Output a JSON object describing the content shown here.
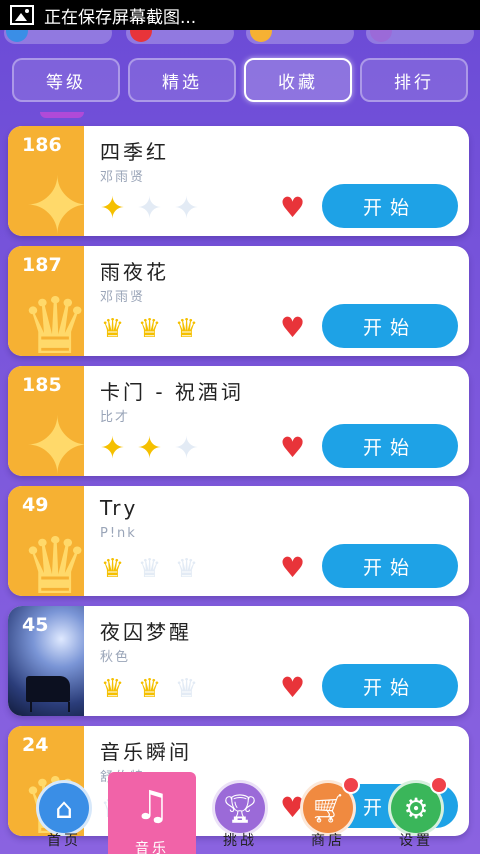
{
  "statusbar": {
    "text": "正在保存屏幕截图..."
  },
  "tabs": [
    {
      "label": "等级"
    },
    {
      "label": "精选"
    },
    {
      "label": "收藏"
    },
    {
      "label": "排行"
    }
  ],
  "songs": [
    {
      "number": "186",
      "title": "四季红",
      "artist": "邓雨贤",
      "rating_type": "star",
      "rating": 1,
      "rating_max": 3,
      "favorite": true,
      "start_label": "开始",
      "badge_color": "#f6b133"
    },
    {
      "number": "187",
      "title": "雨夜花",
      "artist": "邓雨贤",
      "rating_type": "crown",
      "rating": 3,
      "rating_max": 3,
      "favorite": true,
      "start_label": "开始",
      "badge_color": "#f6b133"
    },
    {
      "number": "185",
      "title": "卡门 - 祝酒词",
      "artist": "比才",
      "rating_type": "star",
      "rating": 2,
      "rating_max": 3,
      "favorite": true,
      "start_label": "开始",
      "badge_color": "#f6b133"
    },
    {
      "number": "49",
      "title": "Try",
      "artist": "P!nk",
      "rating_type": "crown",
      "rating": 1,
      "rating_max": 3,
      "favorite": true,
      "start_label": "开始",
      "badge_color": "#f6b133"
    },
    {
      "number": "45",
      "title": "夜囚梦醒",
      "artist": "秋色",
      "rating_type": "crown",
      "rating": 2,
      "rating_max": 3,
      "favorite": true,
      "start_label": "开始",
      "badge_color": "cover"
    },
    {
      "number": "24",
      "title": "音乐瞬间",
      "artist": "舒伯特",
      "rating_type": "crown",
      "rating": 0,
      "rating_max": 3,
      "favorite": true,
      "start_label": "开始",
      "badge_color": "#f6b133"
    }
  ],
  "bottom_nav": [
    {
      "label": "首页",
      "icon": "home-icon",
      "color": "#3a8ee6"
    },
    {
      "label": "音乐",
      "icon": "music-note-icon",
      "color": "#f163a8"
    },
    {
      "label": "挑战",
      "icon": "trophy-icon",
      "color": "#9b6ad8"
    },
    {
      "label": "商店",
      "icon": "cart-icon",
      "color": "#f08a40"
    },
    {
      "label": "设置",
      "icon": "gear-icon",
      "color": "#3ab65a"
    }
  ],
  "colors": {
    "accent": "#1ea2e6",
    "heart": "#e8343a",
    "badge": "#f6b133",
    "star": "#f5c000"
  }
}
